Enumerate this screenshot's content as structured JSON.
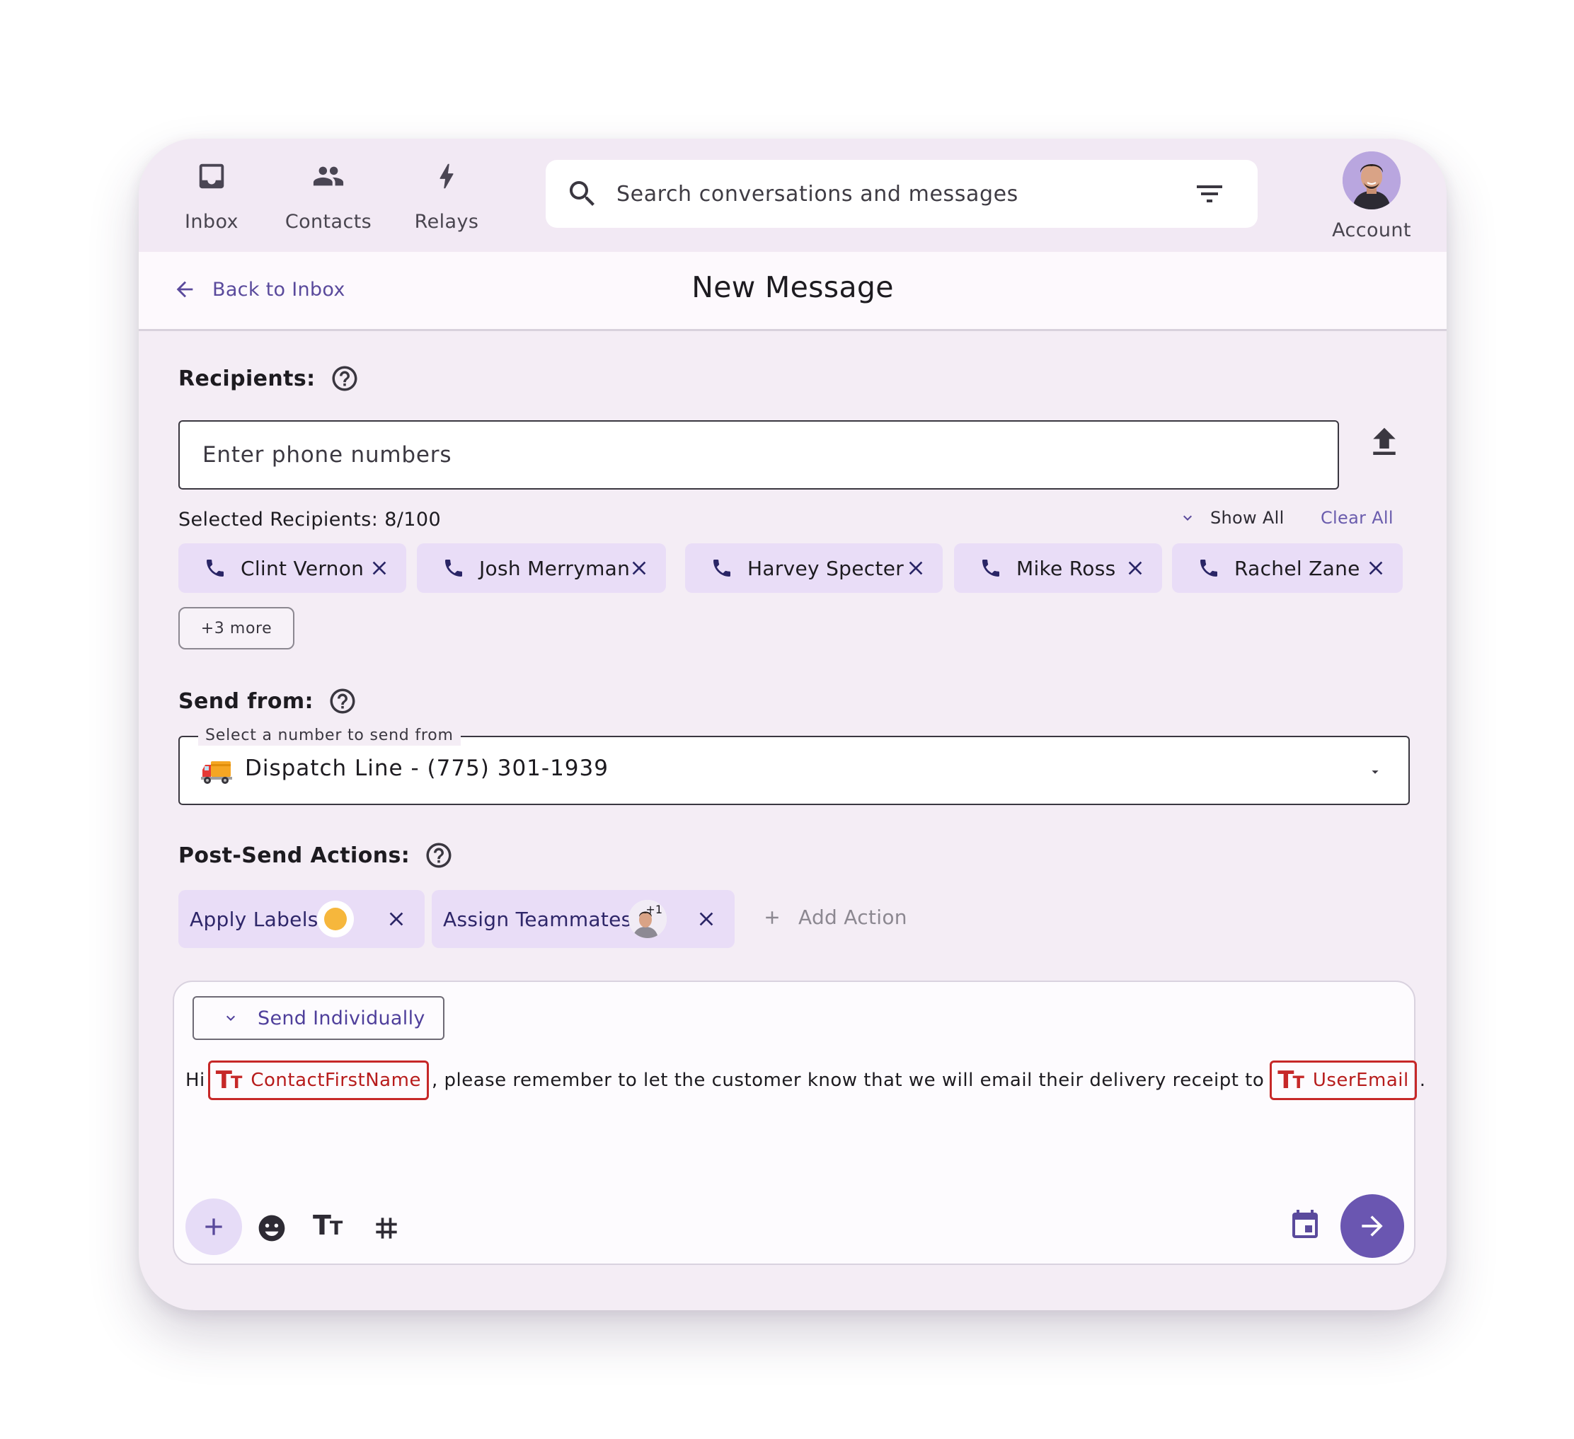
{
  "nav": {
    "items": [
      {
        "label": "Inbox",
        "icon": "inbox-icon"
      },
      {
        "label": "Contacts",
        "icon": "people-icon"
      },
      {
        "label": "Relays",
        "icon": "bolt-icon"
      }
    ],
    "account_label": "Account"
  },
  "search": {
    "placeholder": "Search conversations and messages"
  },
  "header": {
    "back_label": "Back to Inbox",
    "title": "New Message"
  },
  "recipients": {
    "label": "Recipients:",
    "input_placeholder": "Enter phone numbers",
    "selected_count_text": "Selected Recipients: 8/100",
    "show_all_label": "Show All",
    "clear_all_label": "Clear All",
    "chips": [
      "Clint Vernon",
      "Josh Merryman",
      "Harvey Specter",
      "Mike Ross",
      "Rachel Zane"
    ],
    "more_label": "+3 more"
  },
  "send_from": {
    "label": "Send from:",
    "select_label": "Select a number to send from",
    "selected_value": "Dispatch Line - (775) 301-1939",
    "selected_icon": "truck-emoji"
  },
  "post_send": {
    "label": "Post-Send Actions:",
    "actions": [
      {
        "label": "Apply Labels",
        "badge_color": "#f6b73c"
      },
      {
        "label": "Assign Teammates",
        "badge_text": "+1"
      }
    ],
    "add_label": "Add Action"
  },
  "composer": {
    "send_mode": "Send Individually",
    "message": {
      "prefix": "Hi",
      "token1": "ContactFirstName",
      "middle": ", please remember to let the customer know that we will email their delivery receipt to",
      "token2": "UserEmail",
      "suffix": "."
    }
  },
  "colors": {
    "accent": "#6a56b1",
    "chip_bg": "#e9ddf7",
    "token_red": "#c62828",
    "card_bg": "#f4edf5"
  }
}
